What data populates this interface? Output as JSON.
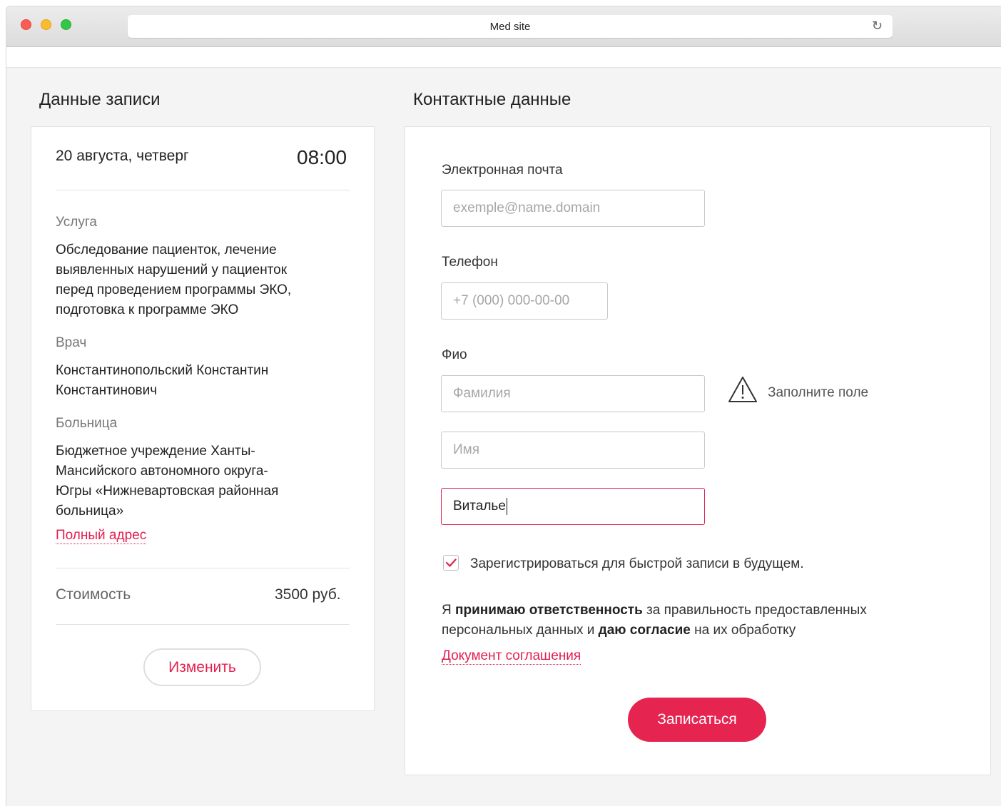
{
  "browser": {
    "title": "Med site",
    "reload_icon": "↻"
  },
  "booking": {
    "section_title": "Данные записи",
    "date": "20 августа, четверг",
    "time": "08:00",
    "service_label": "Услуга",
    "service_value": "Обследование пациенток, лечение выявленных нарушений у пациенток перед проведением программы ЭКО, подготовка к программе ЭКО",
    "doctor_label": "Врач",
    "doctor_value": "Константинопольский Константин Константинович",
    "hospital_label": "Больница",
    "hospital_value": "Бюджетное учреждение Ханты-Мансийского автономного округа-Югры «Нижневартовская районная больница»",
    "full_address_link": "Полный адрес",
    "cost_label": "Стоимость",
    "cost_value": "3500 руб.",
    "change_button": "Изменить"
  },
  "contacts": {
    "section_title": "Контактные данные",
    "email_label": "Электронная почта",
    "email_placeholder": "exemple@name.domain",
    "phone_label": "Телефон",
    "phone_placeholder": "+7 (000) 000-00-00",
    "name_label": "Фио",
    "surname_placeholder": "Фамилия",
    "firstname_placeholder": "Имя",
    "patronymic_value": "Виталье",
    "warning_text": "Заполните поле",
    "register_checked": true,
    "register_label": "Зарегистрироваться для быстрой записи в будущем.",
    "consent_part1": "Я ",
    "consent_bold1": "принимаю ответственность",
    "consent_part2": " за правильность предоставленных персональных данных и ",
    "consent_bold2": "даю согласие",
    "consent_part3": " на их обработку",
    "agreement_link": "Документ соглашения",
    "submit_button": "Записаться"
  },
  "colors": {
    "accent": "#e31e4f",
    "button": "#e5244f",
    "background": "#f4f4f4"
  }
}
